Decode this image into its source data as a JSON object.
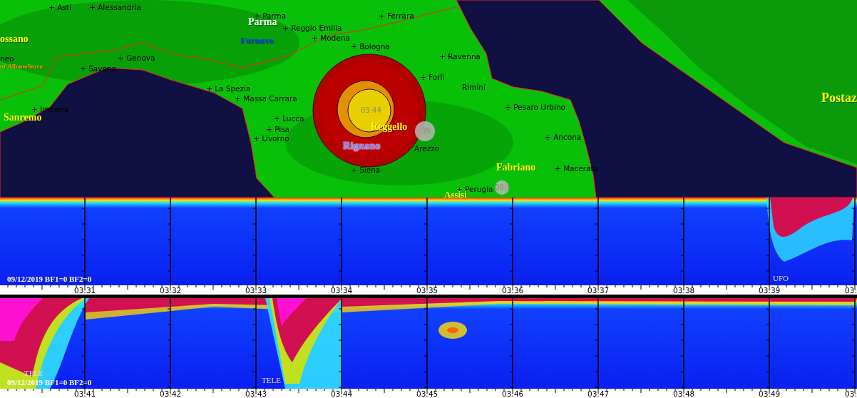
{
  "map": {
    "cities": [
      "+ Asti",
      "+ Alessandria",
      "+ Parma",
      "+ Ferrara",
      "+ Reggio Emilia",
      "+ Modena",
      "+ Bologna",
      "neo",
      "+ Genova",
      "+ Ravenna",
      "+ Savona",
      "+ Forlì",
      "Rimini",
      "+ La Spezia",
      "+ Massa Carrara",
      "+ Imperia",
      "+ Pesaro Urbino",
      "+ Lucca",
      "+ Pisa",
      "+ Ancona",
      "+ Livorno",
      "Arezzo",
      "+ Macerata",
      "+ Siena",
      "+ Perugia"
    ],
    "stations": [
      {
        "name": "ossano",
        "color": "#ffff00"
      },
      {
        "name": "nt'AlbanoStura",
        "color": "#ff9900"
      },
      {
        "name": "Sanremo",
        "color": "#ffff00"
      },
      {
        "name": "Parma",
        "color": "#ffffff"
      },
      {
        "name": "Fornovo",
        "color": "#1030ff"
      },
      {
        "name": "Reggello",
        "color": "#ffff00"
      },
      {
        "name": "Rignano",
        "color": "#7a7aff"
      },
      {
        "name": "Fabriano",
        "color": "#ffff00"
      },
      {
        "name": "Assisi",
        "color": "#ffff00"
      },
      {
        "name": "Postaz",
        "color": "#ffff00"
      }
    ],
    "events": [
      {
        "label": "03:44",
        "kind": "major"
      },
      {
        "label": "35",
        "kind": "minor"
      },
      {
        "label": "00:1",
        "kind": "minor"
      }
    ]
  },
  "spectrograms": [
    {
      "caption": "09/12/2019 BF1=0 BF2=0",
      "tags": [
        "UFO"
      ],
      "time_labels": [
        "03:31",
        "03:32",
        "03:33",
        "03:34",
        "03:35",
        "03:36",
        "03:37",
        "03:38",
        "03:39",
        "03:"
      ]
    },
    {
      "caption": "09/12/2019 BF1=0 BF2=0",
      "tags": [
        "TELE",
        "TELE"
      ],
      "time_labels": [
        "03:41",
        "03:42",
        "03:43",
        "03:44",
        "03:45",
        "03:46",
        "03:47",
        "03:48",
        "03:49",
        "03:"
      ]
    }
  ]
}
